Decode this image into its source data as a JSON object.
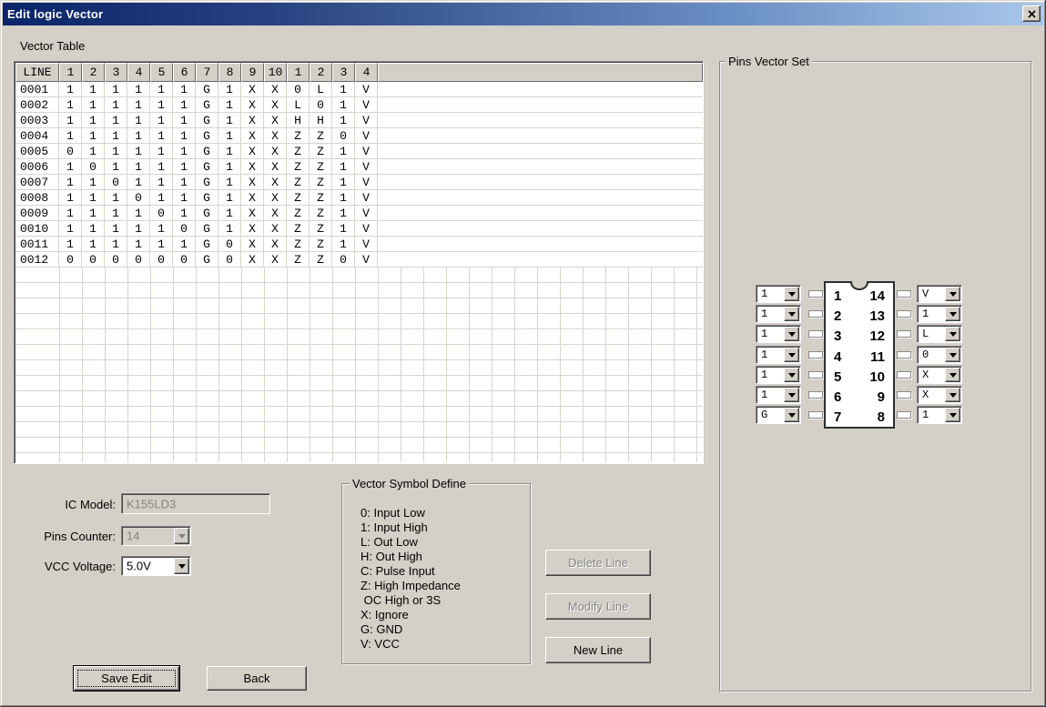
{
  "window": {
    "title": "Edit logic Vector"
  },
  "vector_table": {
    "label": "Vector Table",
    "headers": [
      "LINE",
      "1",
      "2",
      "3",
      "4",
      "5",
      "6",
      "7",
      "8",
      "9",
      "10",
      "1",
      "2",
      "3",
      "4"
    ],
    "rows": [
      [
        "0001",
        "1",
        "1",
        "1",
        "1",
        "1",
        "1",
        "G",
        "1",
        "X",
        "X",
        "0",
        "L",
        "1",
        "V"
      ],
      [
        "0002",
        "1",
        "1",
        "1",
        "1",
        "1",
        "1",
        "G",
        "1",
        "X",
        "X",
        "L",
        "0",
        "1",
        "V"
      ],
      [
        "0003",
        "1",
        "1",
        "1",
        "1",
        "1",
        "1",
        "G",
        "1",
        "X",
        "X",
        "H",
        "H",
        "1",
        "V"
      ],
      [
        "0004",
        "1",
        "1",
        "1",
        "1",
        "1",
        "1",
        "G",
        "1",
        "X",
        "X",
        "Z",
        "Z",
        "0",
        "V"
      ],
      [
        "0005",
        "0",
        "1",
        "1",
        "1",
        "1",
        "1",
        "G",
        "1",
        "X",
        "X",
        "Z",
        "Z",
        "1",
        "V"
      ],
      [
        "0006",
        "1",
        "0",
        "1",
        "1",
        "1",
        "1",
        "G",
        "1",
        "X",
        "X",
        "Z",
        "Z",
        "1",
        "V"
      ],
      [
        "0007",
        "1",
        "1",
        "0",
        "1",
        "1",
        "1",
        "G",
        "1",
        "X",
        "X",
        "Z",
        "Z",
        "1",
        "V"
      ],
      [
        "0008",
        "1",
        "1",
        "1",
        "0",
        "1",
        "1",
        "G",
        "1",
        "X",
        "X",
        "Z",
        "Z",
        "1",
        "V"
      ],
      [
        "0009",
        "1",
        "1",
        "1",
        "1",
        "0",
        "1",
        "G",
        "1",
        "X",
        "X",
        "Z",
        "Z",
        "1",
        "V"
      ],
      [
        "0010",
        "1",
        "1",
        "1",
        "1",
        "1",
        "0",
        "G",
        "1",
        "X",
        "X",
        "Z",
        "Z",
        "1",
        "V"
      ],
      [
        "0011",
        "1",
        "1",
        "1",
        "1",
        "1",
        "1",
        "G",
        "0",
        "X",
        "X",
        "Z",
        "Z",
        "1",
        "V"
      ],
      [
        "0012",
        "0",
        "0",
        "0",
        "0",
        "0",
        "0",
        "G",
        "0",
        "X",
        "X",
        "Z",
        "Z",
        "0",
        "V"
      ]
    ]
  },
  "pins_vector_set": {
    "label": "Pins Vector Set",
    "left_pins": [
      {
        "num": "1",
        "value": "1"
      },
      {
        "num": "2",
        "value": "1"
      },
      {
        "num": "3",
        "value": "1"
      },
      {
        "num": "4",
        "value": "1"
      },
      {
        "num": "5",
        "value": "1"
      },
      {
        "num": "6",
        "value": "1"
      },
      {
        "num": "7",
        "value": "G"
      }
    ],
    "right_pins": [
      {
        "num": "14",
        "value": "V"
      },
      {
        "num": "13",
        "value": "1"
      },
      {
        "num": "12",
        "value": "L"
      },
      {
        "num": "11",
        "value": "0"
      },
      {
        "num": "10",
        "value": "X"
      },
      {
        "num": "9",
        "value": "X"
      },
      {
        "num": "8",
        "value": "1"
      }
    ]
  },
  "form": {
    "ic_model": {
      "label": "IC Model:",
      "value": "K155LD3"
    },
    "pins_counter": {
      "label": "Pins Counter:",
      "value": "14"
    },
    "vcc_voltage": {
      "label": "VCC Voltage:",
      "value": "5.0V"
    }
  },
  "symbol_define": {
    "label": "Vector Symbol Define",
    "lines": [
      "0: Input Low",
      "1: Input High",
      "L: Out Low",
      "H: Out High",
      "C: Pulse Input",
      "Z: High Impedance",
      " OC High or 3S",
      "X: Ignore",
      "G: GND",
      "V: VCC"
    ]
  },
  "buttons": {
    "delete_line": "Delete Line",
    "modify_line": "Modify Line",
    "new_line": "New Line",
    "save_edit": "Save Edit",
    "back": "Back"
  },
  "colors": {
    "dialog_bg": "#d4d0c8",
    "titlebar_start": "#0a246a",
    "titlebar_end": "#a9c7ea",
    "gridline": "#d8d4cc",
    "disabled_text": "#848484"
  }
}
